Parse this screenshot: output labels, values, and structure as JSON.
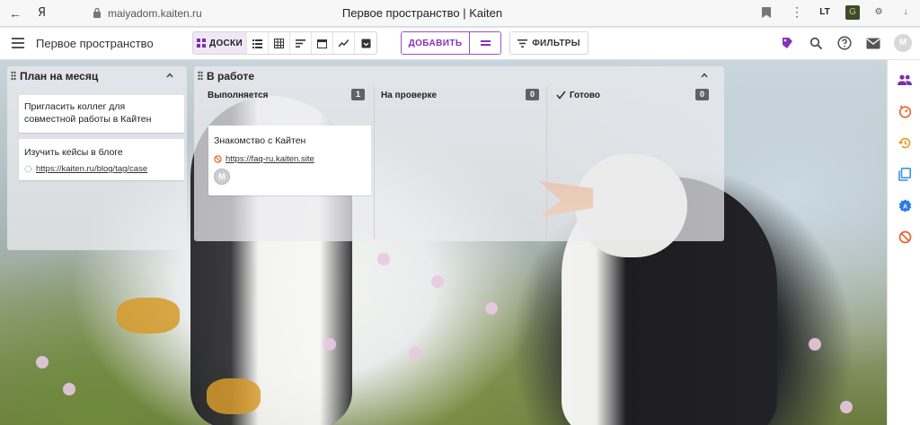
{
  "browser": {
    "url": "maiyadom.kaiten.ru",
    "tab_title": "Первое пространство | Kaiten",
    "ya_logo": "Я",
    "ext_lt": "LT",
    "ext_g": "G"
  },
  "header": {
    "space_title": "Первое пространство",
    "boards_label": "ДОСКИ",
    "add_label": "ДОБАВИТЬ",
    "filters_label": "ФИЛЬТРЫ",
    "avatar_initial": "M"
  },
  "columns": [
    {
      "title": "План на месяц",
      "cards": [
        {
          "title": "Пригласить коллег для совместной работы в Кайтен"
        },
        {
          "title": "Изучить кейсы в блоге",
          "link": "https://kaiten.ru/blog/tag/case"
        }
      ]
    },
    {
      "title": "В работе",
      "subcolumns": [
        {
          "title": "Выполняется",
          "count": "1",
          "cards": [
            {
              "title": "Знакомство с Кайтен",
              "link": "https://faq-ru.kaiten.site",
              "avatar": "M"
            }
          ]
        },
        {
          "title": "На проверке",
          "count": "0"
        },
        {
          "title": "Готово",
          "count": "0"
        }
      ]
    }
  ],
  "colors": {
    "accent": "#8a2fb8",
    "sidebar_users": "#7b2ea8",
    "sidebar_timer": "#e8632b",
    "sidebar_history": "#e89a2b",
    "sidebar_copy": "#2b8fe8",
    "sidebar_auto": "#2b7be8",
    "sidebar_block": "#e8632b"
  }
}
